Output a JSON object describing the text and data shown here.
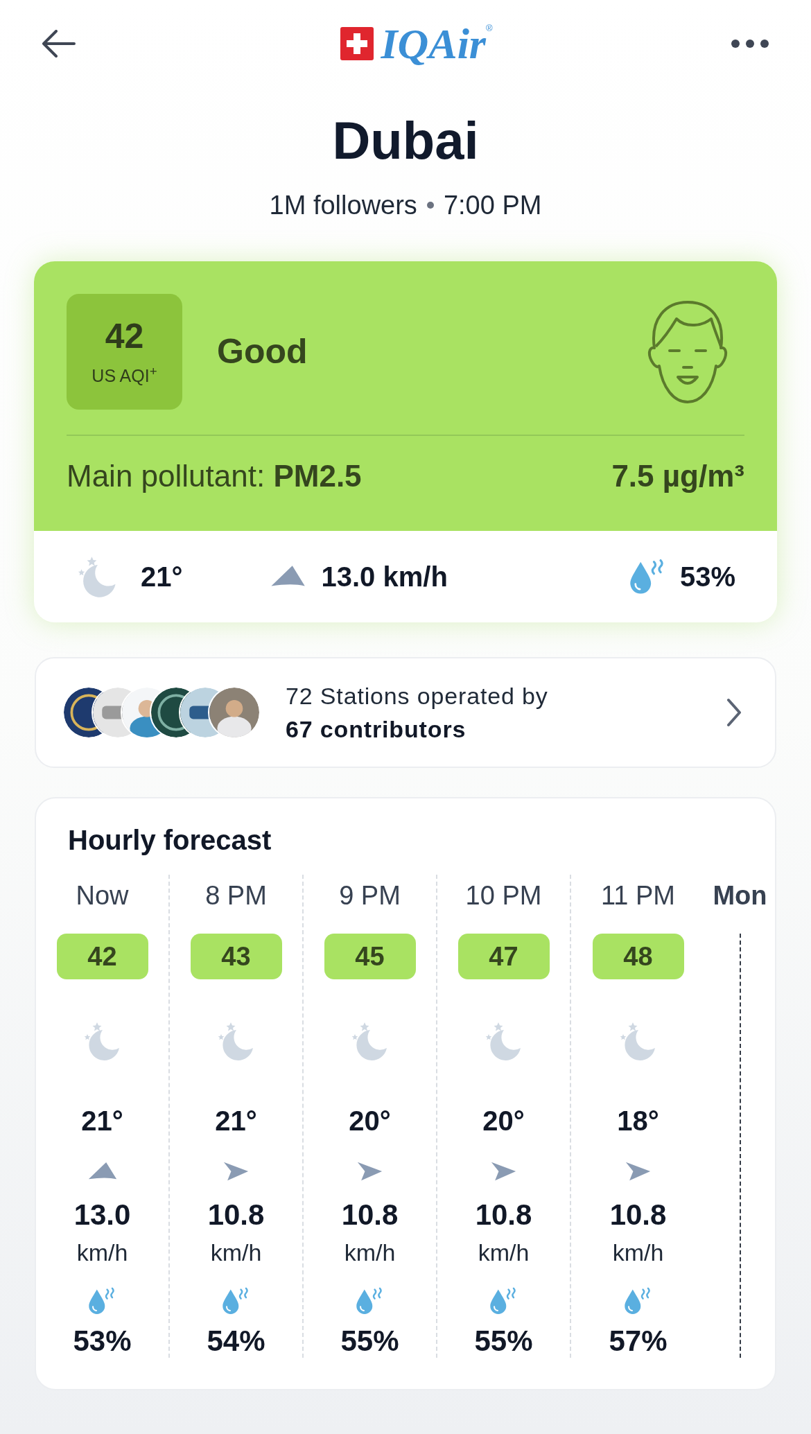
{
  "header": {
    "logo": {
      "text": "IQAir",
      "mark": "®"
    }
  },
  "city": {
    "name": "Dubai",
    "followers": "1M followers",
    "time": "7:00 PM"
  },
  "aqi_card": {
    "value": "42",
    "unit": "US AQI$^{+}$",
    "status": "Good",
    "pollutant": "Main pollutant: **PM2.5**",
    "concentration": "7.5 µg/m³",
    "weather": {
      "temperature": "21°",
      "wind": "13.0 km/h",
      "kind": "northeast",
      "humidity": "53%"
    }
  },
  "stations": {
    "line1": "72 Stations operated by",
    "line2": "67 contributors"
  },
  "hourly": {
    "title": "Hourly forecast",
    "next_day": "Mon",
    "hours": [
      {
        "time": "Now",
        "aqi": "42",
        "temp": "21°",
        "kind": "northeast",
        "wind_speed": "13.0",
        "wind_unit": "km/h",
        "humidity": "53%"
      },
      {
        "time": "8 PM",
        "aqi": "43",
        "temp": "21°",
        "kind": "east",
        "wind_speed": "10.8",
        "wind_unit": "km/h",
        "humidity": "54%"
      },
      {
        "time": "9 PM",
        "aqi": "45",
        "temp": "20°",
        "kind": "east",
        "wind_speed": "10.8",
        "wind_unit": "km/h",
        "humidity": "55%"
      },
      {
        "time": "10 PM",
        "aqi": "47",
        "temp": "20°",
        "kind": "east",
        "wind_speed": "10.8",
        "wind_unit": "km/h",
        "humidity": "55%"
      },
      {
        "time": "11 PM",
        "aqi": "48",
        "temp": "18°",
        "kind": "east",
        "wind_speed": "10.8",
        "wind_unit": "km/h",
        "humidity": "57%"
      }
    ]
  }
}
